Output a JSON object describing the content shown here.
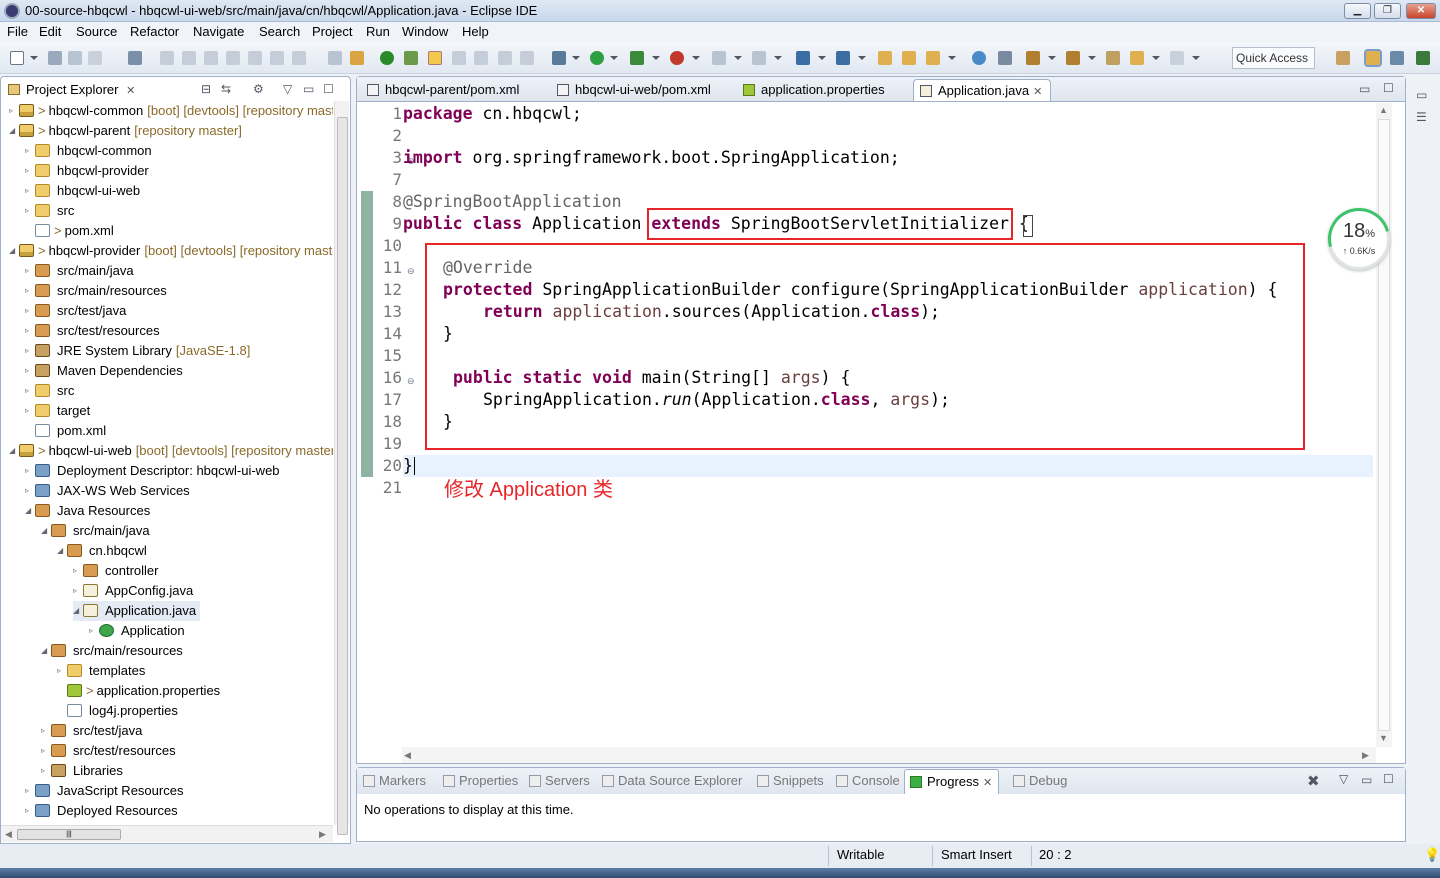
{
  "window": {
    "title": "00-source-hbqcwl - hbqcwl-ui-web/src/main/java/cn/hbqcwl/Application.java - Eclipse IDE"
  },
  "menu": [
    "File",
    "Edit",
    "Source",
    "Refactor",
    "Navigate",
    "Search",
    "Project",
    "Run",
    "Window",
    "Help"
  ],
  "toolbar": {
    "quick_access": "Quick Access"
  },
  "explorer": {
    "title": "Project Explorer",
    "tree": [
      {
        "label": "hbqcwl-common",
        "decor": "[boot] [devtools] [repository master]",
        "prefix": ">"
      },
      {
        "label": "hbqcwl-parent",
        "decor": "[repository master]",
        "prefix": ">"
      },
      {
        "label": "hbqcwl-common",
        "decor": "",
        "prefix": ""
      },
      {
        "label": "hbqcwl-provider",
        "decor": "",
        "prefix": ""
      },
      {
        "label": "hbqcwl-ui-web",
        "decor": "",
        "prefix": ""
      },
      {
        "label": "src",
        "decor": "",
        "prefix": ""
      },
      {
        "label": "pom.xml",
        "decor": "",
        "prefix": ">"
      },
      {
        "label": "hbqcwl-provider",
        "decor": "[boot] [devtools] [repository master]",
        "prefix": ">"
      },
      {
        "label": "src/main/java",
        "decor": "",
        "prefix": ""
      },
      {
        "label": "src/main/resources",
        "decor": "",
        "prefix": ""
      },
      {
        "label": "src/test/java",
        "decor": "",
        "prefix": ""
      },
      {
        "label": "src/test/resources",
        "decor": "",
        "prefix": ""
      },
      {
        "label": "JRE System Library",
        "decor": "[JavaSE-1.8]",
        "prefix": ""
      },
      {
        "label": "Maven Dependencies",
        "decor": "",
        "prefix": ""
      },
      {
        "label": "src",
        "decor": "",
        "prefix": ""
      },
      {
        "label": "target",
        "decor": "",
        "prefix": ""
      },
      {
        "label": "pom.xml",
        "decor": "",
        "prefix": ""
      },
      {
        "label": "hbqcwl-ui-web",
        "decor": "[boot] [devtools] [repository master]",
        "prefix": ">"
      },
      {
        "label": "Deployment Descriptor: hbqcwl-ui-web",
        "decor": "",
        "prefix": ""
      },
      {
        "label": "JAX-WS Web Services",
        "decor": "",
        "prefix": ""
      },
      {
        "label": "Java Resources",
        "decor": "",
        "prefix": ""
      },
      {
        "label": "src/main/java",
        "decor": "",
        "prefix": ""
      },
      {
        "label": "cn.hbqcwl",
        "decor": "",
        "prefix": ""
      },
      {
        "label": "controller",
        "decor": "",
        "prefix": ""
      },
      {
        "label": "AppConfig.java",
        "decor": "",
        "prefix": ""
      },
      {
        "label": "Application.java",
        "decor": "",
        "prefix": ""
      },
      {
        "label": "Application",
        "decor": "",
        "prefix": ""
      },
      {
        "label": "src/main/resources",
        "decor": "",
        "prefix": ""
      },
      {
        "label": "templates",
        "decor": "",
        "prefix": ""
      },
      {
        "label": "application.properties",
        "decor": "",
        "prefix": ">"
      },
      {
        "label": "log4j.properties",
        "decor": "",
        "prefix": ""
      },
      {
        "label": "src/test/java",
        "decor": "",
        "prefix": ""
      },
      {
        "label": "src/test/resources",
        "decor": "",
        "prefix": ""
      },
      {
        "label": "Libraries",
        "decor": "",
        "prefix": ""
      },
      {
        "label": "JavaScript Resources",
        "decor": "",
        "prefix": ""
      },
      {
        "label": "Deployed Resources",
        "decor": "",
        "prefix": ""
      }
    ]
  },
  "editor": {
    "tabs": [
      "hbqcwl-parent/pom.xml",
      "hbqcwl-ui-web/pom.xml",
      "application.properties",
      "Application.java"
    ],
    "active_tab": "Application.java",
    "line_numbers": [
      "1",
      "2",
      "3",
      "7",
      "8",
      "9",
      "10",
      "11",
      "12",
      "13",
      "14",
      "15",
      "16",
      "17",
      "18",
      "19",
      "20",
      "21"
    ],
    "code": {
      "l1_kw": "package",
      "l1_rest": " cn.hbqcwl;",
      "l3_kw": "import",
      "l3_rest": " org.springframework.boot.SpringApplication;",
      "l8": "@SpringBootApplication",
      "l9_kw1": "public class",
      "l9_name": " Application ",
      "l9_kw2": "extends",
      "l9_rest": " SpringBootServletInitializer ",
      "l9_brace": "{",
      "l11": "@Override",
      "l12_kw": "protected",
      "l12_a": " SpringApplicationBuilder configure(SpringApplicationBuilder ",
      "l12_var": "application",
      "l12_b": ") {",
      "l13_kw": "return",
      "l13_var": " application",
      "l13_a": ".sources(Application.",
      "l13_kw2": "class",
      "l13_b": ");",
      "l14": "}",
      "l16_kw": "public static void",
      "l16_a": " main(String[] ",
      "l16_var": "args",
      "l16_b": ") {",
      "l17_a": "SpringApplication.",
      "l17_run": "run",
      "l17_b": "(Application.",
      "l17_kw": "class",
      "l17_c": ", ",
      "l17_var": "args",
      "l17_d": ");",
      "l18": "}",
      "l20": "}"
    },
    "annotation": "修改 Application 类"
  },
  "gauge": {
    "percent": "18",
    "percent_sign": "%",
    "rate": "↑ 0.6K/s"
  },
  "bottom_panel": {
    "tabs": [
      "Markers",
      "Properties",
      "Servers",
      "Data Source Explorer",
      "Snippets",
      "Console",
      "Progress",
      "Debug"
    ],
    "active_tab": "Progress",
    "message": "No operations to display at this time."
  },
  "status": {
    "writable": "Writable",
    "insert_mode": "Smart Insert",
    "position": "20 : 2"
  },
  "colors": {
    "highlight_box": "#e8262a",
    "keyword": "#7f0055",
    "annotation": "#646464"
  }
}
